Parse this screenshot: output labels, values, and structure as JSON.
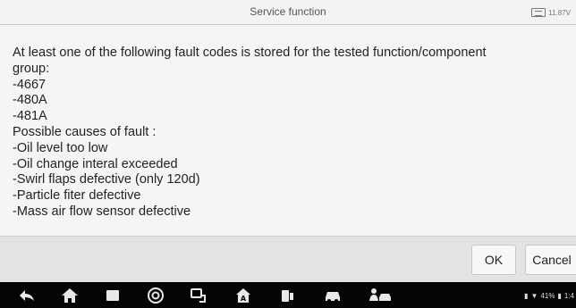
{
  "title_bar": {
    "title": "Service function",
    "voltage": "11.87V"
  },
  "message": {
    "lines": [
      "At least one of the following fault codes is stored for the tested function/component",
      "group:",
      "-4667",
      "-480A",
      "-481A",
      "Possible causes of fault :",
      "-Oil level too low",
      "-Oil change interal exceeded",
      "-Swirl flaps defective (only 120d)",
      "-Particle fiter defective",
      "-Mass air flow sensor defective"
    ]
  },
  "buttons": {
    "ok": "OK",
    "cancel": "Cancel"
  },
  "nav_bar": {
    "icons": [
      "back-icon",
      "home-icon",
      "recent-apps-icon",
      "browser-icon",
      "vci-connect-icon",
      "autel-home-icon",
      "car-tool-icon",
      "car-icon",
      "technician-car-icon"
    ],
    "status": {
      "battery_percent": "41%",
      "time": "1:4"
    }
  }
}
